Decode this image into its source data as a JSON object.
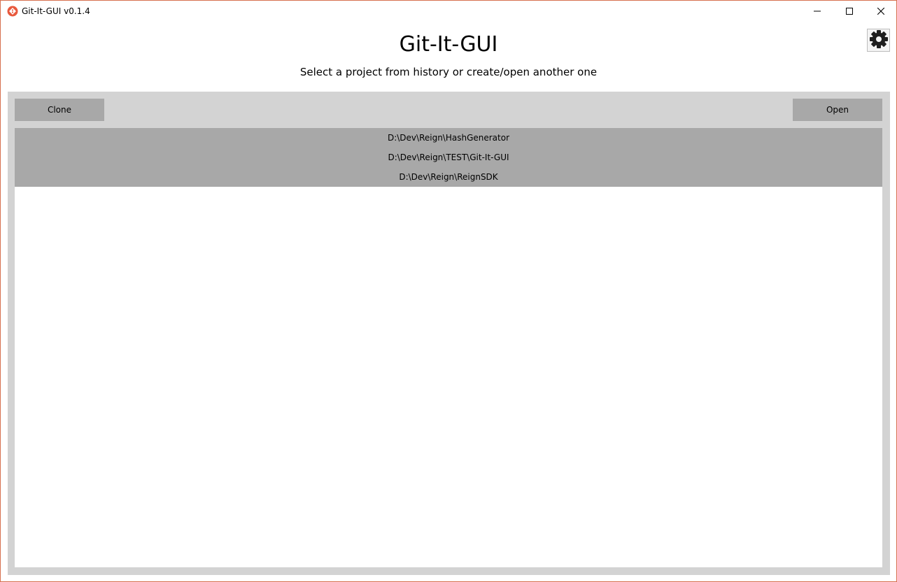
{
  "window": {
    "title": "Git-It-GUI v0.1.4",
    "border_color": "#d7704f",
    "controls": [
      "minimize-icon",
      "maximize-icon",
      "close-icon"
    ]
  },
  "header": {
    "title": "Git-It-GUI",
    "subtitle": "Select a project from history or create/open another one",
    "settings_icon": "gear-icon"
  },
  "toolbar": {
    "clone_label": "Clone",
    "open_label": "Open"
  },
  "history": {
    "items": [
      "D:\\Dev\\Reign\\HashGenerator",
      "D:\\Dev\\Reign\\TEST\\Git-It-GUI",
      "D:\\Dev\\Reign\\ReignSDK"
    ]
  },
  "colors": {
    "panel_bg": "#d3d3d3",
    "button_bg": "#a8a8a8",
    "item_bg": "#a8a8a8",
    "app_icon": "#e8593d"
  }
}
